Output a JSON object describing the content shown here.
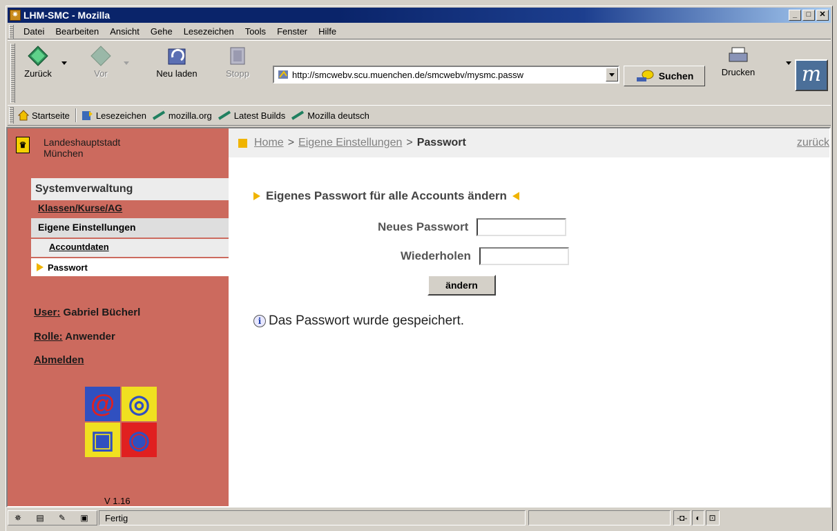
{
  "window": {
    "title": "LHM-SMC - Mozilla"
  },
  "menu": [
    "Datei",
    "Bearbeiten",
    "Ansicht",
    "Gehe",
    "Lesezeichen",
    "Tools",
    "Fenster",
    "Hilfe"
  ],
  "toolbar": {
    "back": "Zurück",
    "forward": "Vor",
    "reload": "Neu laden",
    "stop": "Stopp",
    "url": "http://smcwebv.scu.muenchen.de/smcwebv/mysmc.passw",
    "search": "Suchen",
    "print": "Drucken"
  },
  "personal": {
    "home": "Startseite",
    "bookmarks": "Lesezeichen",
    "links": [
      "mozilla.org",
      "Latest Builds",
      "Mozilla deutsch"
    ]
  },
  "sidebar": {
    "city_line1": "Landeshauptstadt",
    "city_line2": "München",
    "section": "Systemverwaltung",
    "klassen": "Klassen/Kurse/AG",
    "eigene": "Eigene Einstellungen",
    "accountdaten": "Accountdaten",
    "passwort": "Passwort",
    "user_label": "User:",
    "user_value": "Gabriel Bücherl",
    "role_label": "Rolle:",
    "role_value": "Anwender",
    "logout": "Abmelden",
    "version": "V 1.16"
  },
  "breadcrumb": {
    "home": "Home",
    "settings": "Eigene Einstellungen",
    "current": "Passwort",
    "separator": ">",
    "back": "zurück"
  },
  "form": {
    "title": "Eigenes Passwort für alle Accounts ändern",
    "new_label": "Neues Passwort",
    "repeat_label": "Wiederholen",
    "new_value": "",
    "repeat_value": "",
    "submit": "ändern",
    "message": "Das Passwort wurde gespeichert."
  },
  "status": {
    "text": "Fertig"
  }
}
